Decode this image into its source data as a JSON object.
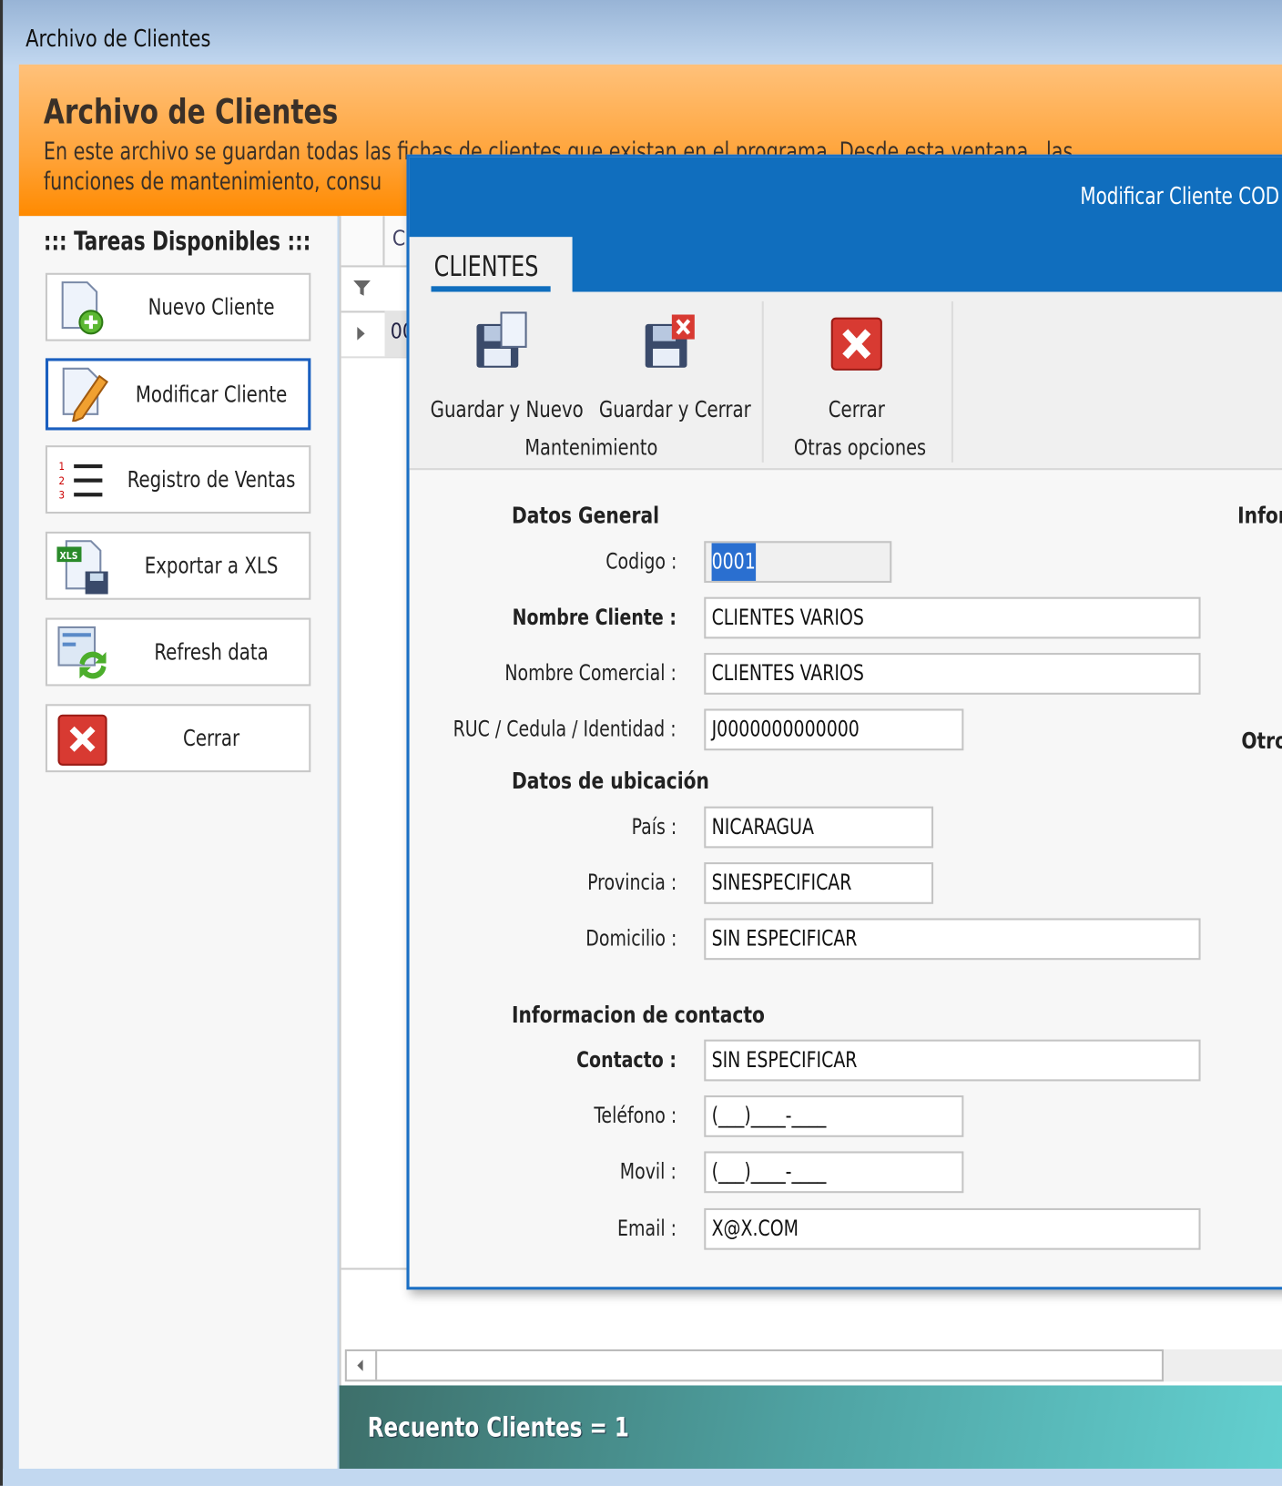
{
  "window": {
    "title": "Archivo de Clientes"
  },
  "banner": {
    "title": "Archivo de Clientes",
    "line1": "En este archivo se guardan todas las fichas de clientes que existan en el programa. Desde esta ventana , las",
    "line2": "funciones de mantenimiento, consu"
  },
  "sidebar": {
    "heading": "::: Tareas Disponibles :::",
    "items": [
      {
        "label": "Nuevo Cliente",
        "icon": "new-document-icon"
      },
      {
        "label": "Modificar Cliente",
        "icon": "edit-document-icon",
        "selected": true
      },
      {
        "label": "Registro de Ventas",
        "icon": "numbered-list-icon"
      },
      {
        "label": "Exportar a XLS",
        "icon": "excel-export-icon"
      },
      {
        "label": "Refresh data",
        "icon": "refresh-icon"
      },
      {
        "label": "Cerrar",
        "icon": "close-icon"
      }
    ]
  },
  "grid": {
    "header_partial": "C",
    "row_partial": "00"
  },
  "status": {
    "text": "Recuento Clientes = 1"
  },
  "dialog": {
    "title": "Modificar Cliente COD :",
    "tab": "CLIENTES",
    "ribbon": {
      "buttons": [
        {
          "label": "Guardar y Nuevo"
        },
        {
          "label": "Guardar y Cerrar"
        },
        {
          "label": "Cerrar"
        }
      ],
      "groups": [
        "Mantenimiento",
        "Otras opciones"
      ]
    },
    "right_partial": {
      "info": "Infor",
      "other": "Otro"
    },
    "sections": {
      "general": "Datos General",
      "ubicacion": "Datos de ubicación",
      "contacto": "Informacion de contacto"
    },
    "fields": {
      "codigo": {
        "label": "Codigo :",
        "value": "0001"
      },
      "nombre": {
        "label": "Nombre Cliente :",
        "value": "CLIENTES VARIOS"
      },
      "comercial": {
        "label": "Nombre Comercial :",
        "value": "CLIENTES VARIOS"
      },
      "ruc": {
        "label": "RUC / Cedula / Identidad :",
        "value": "J0000000000000"
      },
      "pais": {
        "label": "País :",
        "value": "NICARAGUA"
      },
      "provincia": {
        "label": "Provincia :",
        "value": "SINESPECIFICAR"
      },
      "domicilio": {
        "label": "Domicilio :",
        "value": "SIN ESPECIFICAR"
      },
      "contacto": {
        "label": "Contacto :",
        "value": "SIN ESPECIFICAR"
      },
      "telefono": {
        "label": "Teléfono :",
        "value": "(___)____-____"
      },
      "movil": {
        "label": "Movil :",
        "value": "(___)____-____"
      },
      "email": {
        "label": "Email :",
        "value": "X@X.COM"
      }
    }
  },
  "colors": {
    "accent": "#106ebe",
    "banner": "#ff9a20",
    "status": "#4fa3a3"
  }
}
